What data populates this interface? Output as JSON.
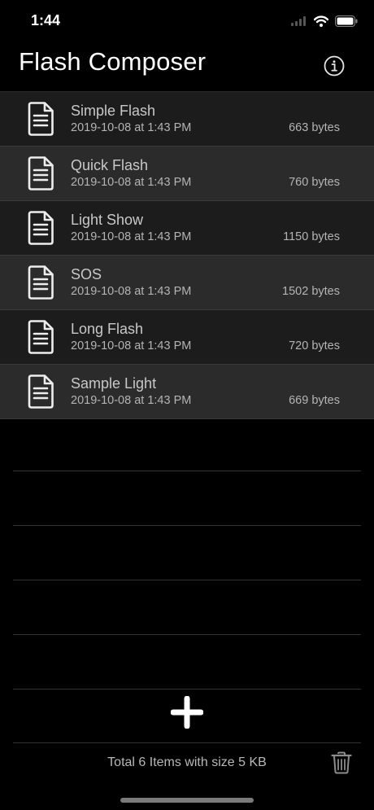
{
  "status": {
    "time": "1:44"
  },
  "nav": {
    "title": "Flash Composer"
  },
  "files": [
    {
      "name": "Simple Flash",
      "date": "2019-10-08 at 1:43 PM",
      "size": "663 bytes"
    },
    {
      "name": "Quick Flash",
      "date": "2019-10-08 at 1:43 PM",
      "size": "760 bytes"
    },
    {
      "name": "Light Show",
      "date": "2019-10-08 at 1:43 PM",
      "size": "1150 bytes"
    },
    {
      "name": "SOS",
      "date": "2019-10-08 at 1:43 PM",
      "size": "1502 bytes"
    },
    {
      "name": "Long Flash",
      "date": "2019-10-08 at 1:43 PM",
      "size": "720 bytes"
    },
    {
      "name": "Sample Light",
      "date": "2019-10-08 at 1:43 PM",
      "size": "669 bytes"
    }
  ],
  "footer": {
    "summary": "Total 6 Items with size 5 KB"
  },
  "icons": {
    "file": "document-icon",
    "info": "info-icon",
    "add": "plus-icon",
    "trash": "trash-icon"
  },
  "colors": {
    "background": "#000000",
    "row_odd": "#1c1c1c",
    "row_even": "#2b2b2b"
  }
}
